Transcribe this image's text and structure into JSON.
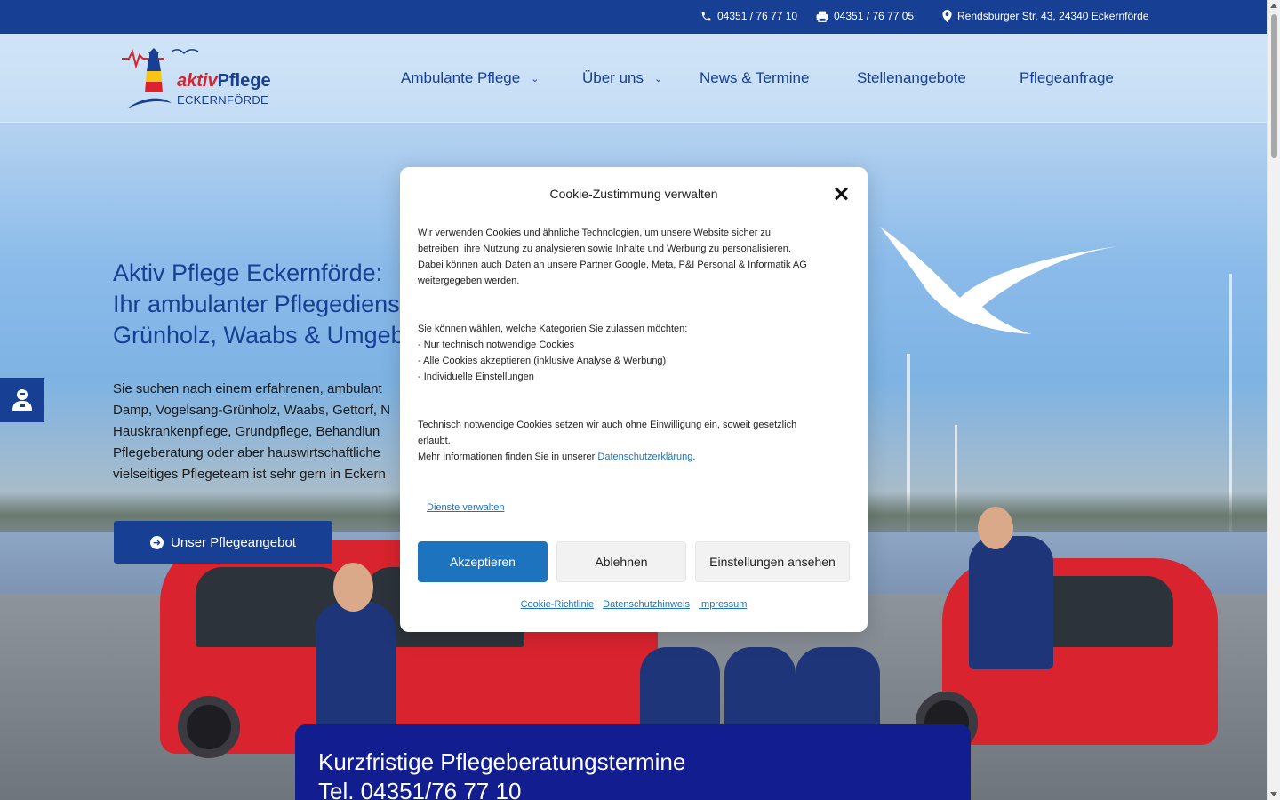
{
  "topbar": {
    "phone": "04351 / 76 77 10",
    "fax": "04351 / 76 77 05",
    "address": "Rendsburger Str. 43, 24340 Eckernförde",
    "phone_icon": "phone-icon",
    "fax_icon": "fax-icon",
    "address_icon": "map-pin-icon"
  },
  "logo": {
    "brand_prefix": "aktiv",
    "brand_name": "Pflege",
    "sub": "ECKERNFÖRDE"
  },
  "nav": {
    "items": [
      {
        "label": "Ambulante Pflege",
        "dropdown": true
      },
      {
        "label": "Über uns",
        "dropdown": true
      },
      {
        "label": "News & Termine",
        "dropdown": false
      },
      {
        "label": "Stellenangebote",
        "dropdown": false
      },
      {
        "label": "Pflegeanfrage",
        "dropdown": false
      }
    ],
    "chevron": "⌄"
  },
  "hero": {
    "title_line1": "Aktiv Pflege Eckernförde:",
    "title_line2": "Ihr ambulanter Pflegediens",
    "title_line3": "Grünholz, Waabs & Umgeb",
    "text_line1": "Sie suchen nach einem erfahrenen, ambulant",
    "text_line2": "Damp, Vogelsang-Grünholz, Waabs, Gettorf, N",
    "text_line3": "Hauskrankenpflege, Grundpflege, Behandlun",
    "text_line4": "Pflegeberatung oder aber hauswirtschaftliche",
    "text_line5": "vielseitiges Pflegeteam ist sehr gern in Eckern",
    "cta_label": "Unser Pflegeangebot",
    "cta_icon": "arrow-right-circle-icon"
  },
  "accessibility": {
    "icon": "accessibility-icon"
  },
  "banner": {
    "line1": "Kurzfristige Pflegeberatungstermine",
    "line2": "Tel. 04351/76 77 10"
  },
  "cookie": {
    "title": "Cookie-Zustimmung verwalten",
    "p1_line1": "Wir verwenden Cookies und ähnliche Technologien, um unsere Website sicher zu",
    "p1_line2": "betreiben, ihre Nutzung zu analysieren sowie Inhalte und Werbung zu personalisieren.",
    "p1_line3": "Dabei können auch Daten an unsere Partner Google, Meta, P&I Personal & Informatik AG",
    "p1_line4": "weitergegeben werden.",
    "p2_line1": "Sie können wählen, welche Kategorien Sie zulassen möchten:",
    "p2_line2": "- Nur technisch notwendige Cookies",
    "p2_line3": "- Alle Cookies akzeptieren (inklusive Analyse & Werbung)",
    "p2_line4": "- Individuelle Einstellungen",
    "p3_line1": "Technisch notwendige Cookies setzen wir auch ohne Einwilligung ein, soweit gesetzlich",
    "p3_line2": "erlaubt.",
    "p3_line3_prefix": "Mehr Informationen finden Sie in unserer ",
    "p3_link": "Datenschutzerklärung",
    "p3_suffix": ".",
    "manage": "Dienste verwalten",
    "accept": "Akzeptieren",
    "deny": "Ablehnen",
    "prefs": "Einstellungen ansehen",
    "footer_links": [
      "Cookie-Richtlinie",
      "Datenschutzhinweis",
      "Impressum"
    ],
    "close_icon": "close-icon"
  },
  "colors": {
    "brand_blue": "#173f94",
    "brand_red": "#d9232e",
    "accept_blue": "#1e73be",
    "banner_blue": "#121d8f"
  }
}
